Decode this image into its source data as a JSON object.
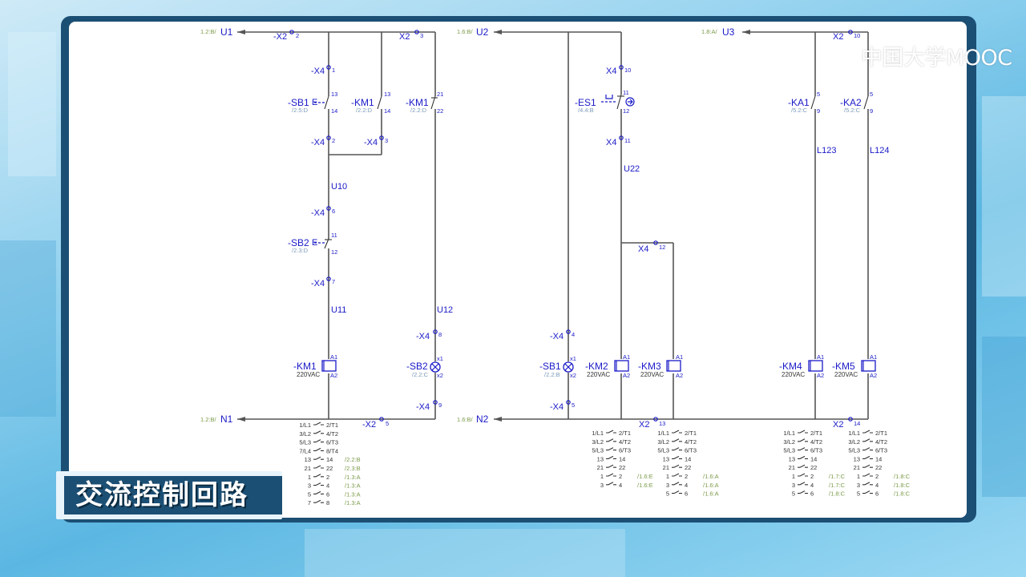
{
  "caption": "交流控制回路",
  "logo": {
    "text": "中国大学MOOC"
  },
  "colors": {
    "wire": "#555555",
    "label": "#1a1ac8",
    "ref": "#7c9b4a",
    "frame": "#1c4f74"
  },
  "potentials": {
    "u1": "U1",
    "u1_ref": "1.2:B/",
    "n1": "N1",
    "n1_ref": "1.2:B/",
    "u2": "U2",
    "u2_ref": "1.6:B/",
    "n2": "N2",
    "n2_ref": "1.6:B/",
    "u3": "U3",
    "u3_ref": "1.8:A/"
  },
  "terminals": {
    "x2_2": "-X2",
    "x2_2p": "2",
    "x2_3": "X2",
    "x2_3p": "3",
    "x4_1": "-X4",
    "x4_1p": "1",
    "x4_2": "-X4",
    "x4_2p": "2",
    "x4_3": "-X4",
    "x4_3p": "3",
    "x4_6": "-X4",
    "x4_6p": "6",
    "x4_7": "-X4",
    "x4_7p": "7",
    "x4_8": "-X4",
    "x4_8p": "8",
    "x4_9": "-X4",
    "x4_9p": "9",
    "x2_5": "-X2",
    "x2_5p": "5",
    "x4_10": "X4",
    "x4_10p": "10",
    "x4_11": "X4",
    "x4_11p": "11",
    "x4_12": "X4",
    "x4_12p": "12",
    "x4_4": "-X4",
    "x4_4p": "4",
    "x4_5": "-X4",
    "x4_5p": "5",
    "x2_13": "X2",
    "x2_13p": "13",
    "x2_10": "X2",
    "x2_10p": "10",
    "x2_14": "X2",
    "x2_14p": "14"
  },
  "wires": {
    "u10": "U10",
    "u11": "U11",
    "u12": "U12",
    "u22": "U22",
    "l123": "L123",
    "l124": "L124"
  },
  "devices": {
    "sb1": {
      "name": "-SB1",
      "ref": "/2.5:D",
      "p1": "13",
      "p2": "14"
    },
    "km1a": {
      "name": "-KM1",
      "ref": "/2.2:D",
      "p1": "13",
      "p2": "14"
    },
    "km1b": {
      "name": "-KM1",
      "ref": "/2.2:D",
      "p1": "21",
      "p2": "22"
    },
    "sb2": {
      "name": "-SB2",
      "ref": "/2.3:D",
      "p1": "11",
      "p2": "12"
    },
    "km1coil": {
      "name": "-KM1",
      "volt": "220VAC",
      "a1": "A1",
      "a2": "A2"
    },
    "sb2lamp": {
      "name": "-SB2",
      "ref": "/2.2:C",
      "x1": "x1",
      "x2": "x2"
    },
    "es1": {
      "name": "-ES1",
      "ref": "/4.4:B",
      "p1": "11",
      "p2": "12"
    },
    "sb1lamp": {
      "name": "-SB1",
      "ref": "/2.2:B",
      "x1": "x1",
      "x2": "x2"
    },
    "km2coil": {
      "name": "-KM2",
      "volt": "220VAC",
      "a1": "A1",
      "a2": "A2"
    },
    "km3coil": {
      "name": "-KM3",
      "volt": "220VAC",
      "a1": "A1",
      "a2": "A2"
    },
    "ka1": {
      "name": "-KA1",
      "ref": "/5.2:C",
      "p1": "5",
      "p2": "9"
    },
    "ka2": {
      "name": "-KA2",
      "ref": "/5.2:C",
      "p1": "5",
      "p2": "9"
    },
    "km4coil": {
      "name": "-KM4",
      "volt": "220VAC",
      "a1": "A1",
      "a2": "A2"
    },
    "km5coil": {
      "name": "-KM5",
      "volt": "220VAC",
      "a1": "A1",
      "a2": "A2"
    }
  },
  "contact_tables": {
    "km1": [
      [
        "1/L1",
        "2/T1",
        ""
      ],
      [
        "3/L2",
        "4/T2",
        ""
      ],
      [
        "5/L3",
        "6/T3",
        ""
      ],
      [
        "7/L4",
        "8/T4",
        ""
      ],
      [
        "13",
        "14",
        "/2.2:B"
      ],
      [
        "21",
        "22",
        "/2.3:B"
      ],
      [
        "1",
        "2",
        "/1.3:A"
      ],
      [
        "3",
        "4",
        "/1.3:A"
      ],
      [
        "5",
        "6",
        "/1.3:A"
      ],
      [
        "7",
        "8",
        "/1.3:A"
      ]
    ],
    "km2": [
      [
        "1/L1",
        "2/T1",
        ""
      ],
      [
        "3/L2",
        "4/T2",
        ""
      ],
      [
        "5/L3",
        "6/T3",
        ""
      ],
      [
        "13",
        "14",
        ""
      ],
      [
        "21",
        "22",
        ""
      ],
      [
        "1",
        "2",
        "/1.6:E"
      ],
      [
        "3",
        "4",
        "/1.6:E"
      ]
    ],
    "km3": [
      [
        "1/L1",
        "2/T1",
        ""
      ],
      [
        "3/L2",
        "4/T2",
        ""
      ],
      [
        "5/L3",
        "6/T3",
        ""
      ],
      [
        "13",
        "14",
        ""
      ],
      [
        "21",
        "22",
        ""
      ],
      [
        "1",
        "2",
        "/1.6:A"
      ],
      [
        "3",
        "4",
        "/1.6:A"
      ],
      [
        "5",
        "6",
        "/1.6:A"
      ]
    ],
    "km4": [
      [
        "1/L1",
        "2/T1",
        ""
      ],
      [
        "3/L2",
        "4/T2",
        ""
      ],
      [
        "5/L3",
        "6/T3",
        ""
      ],
      [
        "13",
        "14",
        ""
      ],
      [
        "21",
        "22",
        ""
      ],
      [
        "1",
        "2",
        "/1.7:C"
      ],
      [
        "3",
        "4",
        "/1.7:C"
      ],
      [
        "5",
        "6",
        "/1.8:C"
      ]
    ],
    "km5": [
      [
        "1/L1",
        "2/T1",
        ""
      ],
      [
        "3/L2",
        "4/T2",
        ""
      ],
      [
        "5/L3",
        "6/T3",
        ""
      ],
      [
        "13",
        "14",
        ""
      ],
      [
        "21",
        "22",
        ""
      ],
      [
        "1",
        "2",
        "/1.8:C"
      ],
      [
        "3",
        "4",
        "/1.8:C"
      ],
      [
        "5",
        "6",
        "/1.8:C"
      ]
    ]
  }
}
